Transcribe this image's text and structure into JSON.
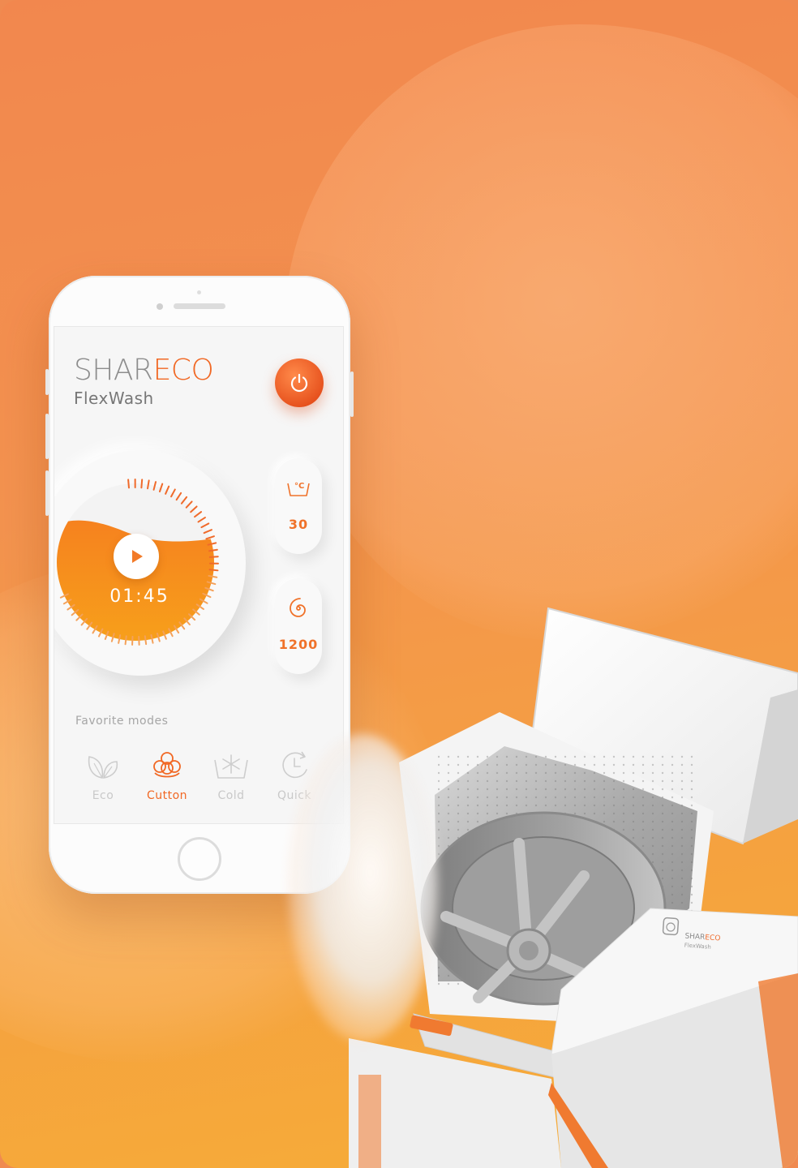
{
  "app": {
    "brand_part1": "SHAR",
    "brand_part2": "ECO",
    "product_name": "FlexWash"
  },
  "controls": {
    "power_icon": "power-icon",
    "timer": "01:45",
    "play_icon": "play-icon",
    "temperature": {
      "icon": "celsius-basin-icon",
      "value": "30"
    },
    "spin": {
      "icon": "spin-spiral-icon",
      "value": "1200"
    }
  },
  "favorites": {
    "label": "Favorite modes",
    "modes": [
      {
        "label": "Eco",
        "icon": "leaves-icon",
        "active": false
      },
      {
        "label": "Cutton",
        "icon": "cotton-flower-icon",
        "active": true
      },
      {
        "label": "Cold",
        "icon": "snowflake-basin-icon",
        "active": false
      },
      {
        "label": "Quick",
        "icon": "clock-cycle-icon",
        "active": false
      }
    ]
  },
  "washer_panel": {
    "brand_part1": "SHAR",
    "brand_part2": "ECO",
    "model": "FlexWash",
    "power_icon": "power-icon"
  },
  "colors": {
    "accent": "#f16824",
    "background_top": "#f2874e",
    "background_bottom": "#f6ad37",
    "screen": "#f6f6f6"
  }
}
